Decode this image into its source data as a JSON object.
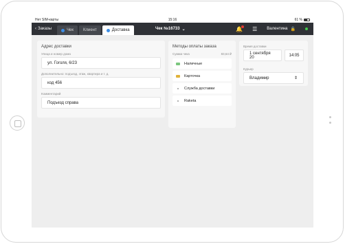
{
  "status_bar": {
    "carrier": "Нет SIM-карты",
    "time": "15:16",
    "battery_pct": "61 %",
    "battery_level": 0.61
  },
  "topbar": {
    "back_label": "Заказы",
    "tabs": [
      {
        "label": "Чек",
        "active": false
      },
      {
        "label": "Клиент",
        "active": false
      },
      {
        "label": "Доставка",
        "active": true
      }
    ],
    "order_title": "Чек №16733",
    "user_name": "Валентина"
  },
  "address": {
    "title": "Адрес доставки",
    "street_label": "Улица и номер дома",
    "street_value": "ул. Гоголя, 6/23",
    "extra_label": "Дополнительно: подъезд, этаж, квартира и т. д.",
    "extra_value": "код 456",
    "comment_label": "Комментарий",
    "comment_value": "Подъезд справа"
  },
  "payment": {
    "title": "Методы оплаты заказа",
    "sum_label": "Сумма чека",
    "sum_value": "83,64 ₽",
    "methods": [
      {
        "label": "Наличные",
        "icon": "cash-icon"
      },
      {
        "label": "Карточка",
        "icon": "card-icon"
      },
      {
        "label": "Служба доставки",
        "icon": "dot-icon"
      },
      {
        "label": "Raketa",
        "icon": "dot-icon"
      }
    ]
  },
  "courier": {
    "time_title": "Время доставки",
    "date_value": "1 сентября 20",
    "time_value": "14:05",
    "courier_label": "Курьер",
    "courier_value": "Владимир"
  }
}
